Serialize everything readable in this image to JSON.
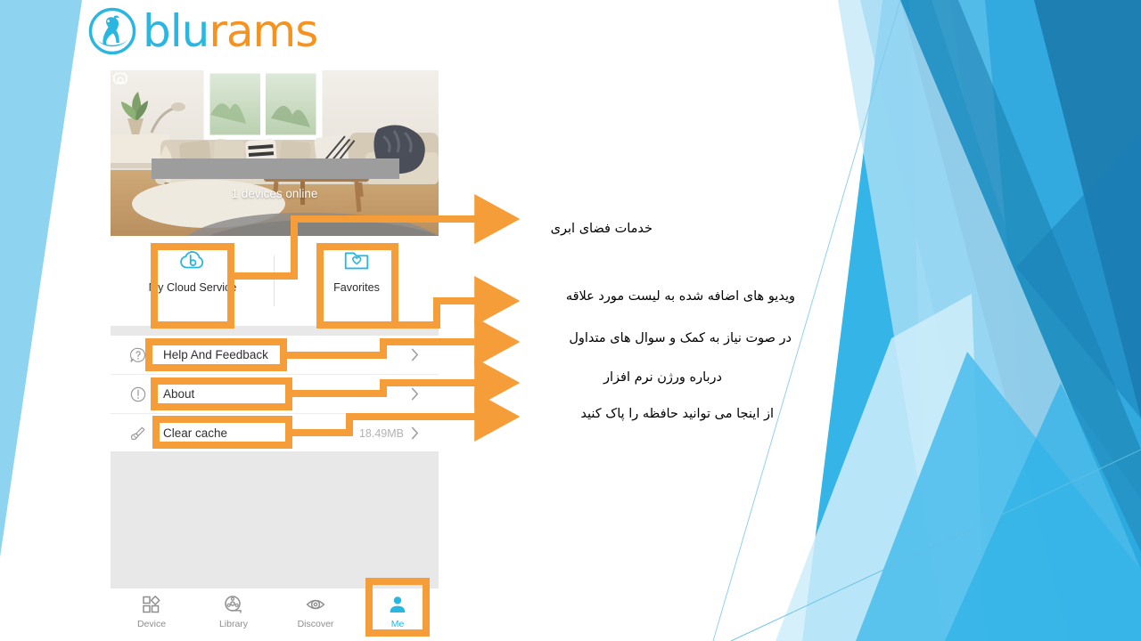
{
  "brand": {
    "name_part1": "blu",
    "name_part2": "rams",
    "logo_icon": "ram-badge-icon",
    "color_cyan": "#29B6E0",
    "color_orange": "#F6921E"
  },
  "app": {
    "preview": {
      "status_text": "1 devices online",
      "settings_icon": "gear-icon",
      "redacted_label": ""
    },
    "tiles": [
      {
        "label": "My Cloud Service",
        "icon": "cloud-b-icon"
      },
      {
        "label": "Favorites",
        "icon": "folder-heart-icon"
      }
    ],
    "rows": [
      {
        "label": "Help And Feedback",
        "value": "",
        "icon": "question-bubble-icon",
        "chevron": "chevron-right-icon"
      },
      {
        "label": "About",
        "value": "",
        "icon": "exclamation-circle-icon",
        "chevron": "chevron-right-icon"
      },
      {
        "label": "Clear cache",
        "value": "18.49MB",
        "icon": "duster-icon",
        "chevron": "chevron-right-icon"
      }
    ],
    "tabs": [
      {
        "label": "Device",
        "icon": "grid-shapes-icon",
        "active": false
      },
      {
        "label": "Library",
        "icon": "film-reel-icon",
        "active": false
      },
      {
        "label": "Discover",
        "icon": "eye-icon",
        "active": false
      },
      {
        "label": "Me",
        "icon": "person-icon",
        "active": true
      }
    ]
  },
  "annotations": {
    "highlight_color": "#F59E39",
    "notes": [
      "خدمات فضای ابری",
      "ویدیو های اضافه شده به لیست مورد علاقه",
      "در صوت نیاز به کمک و سوال های متداول",
      "درباره ورژن نرم افزار",
      "از اینجا می توانید حافظه را پاک کنید"
    ]
  }
}
